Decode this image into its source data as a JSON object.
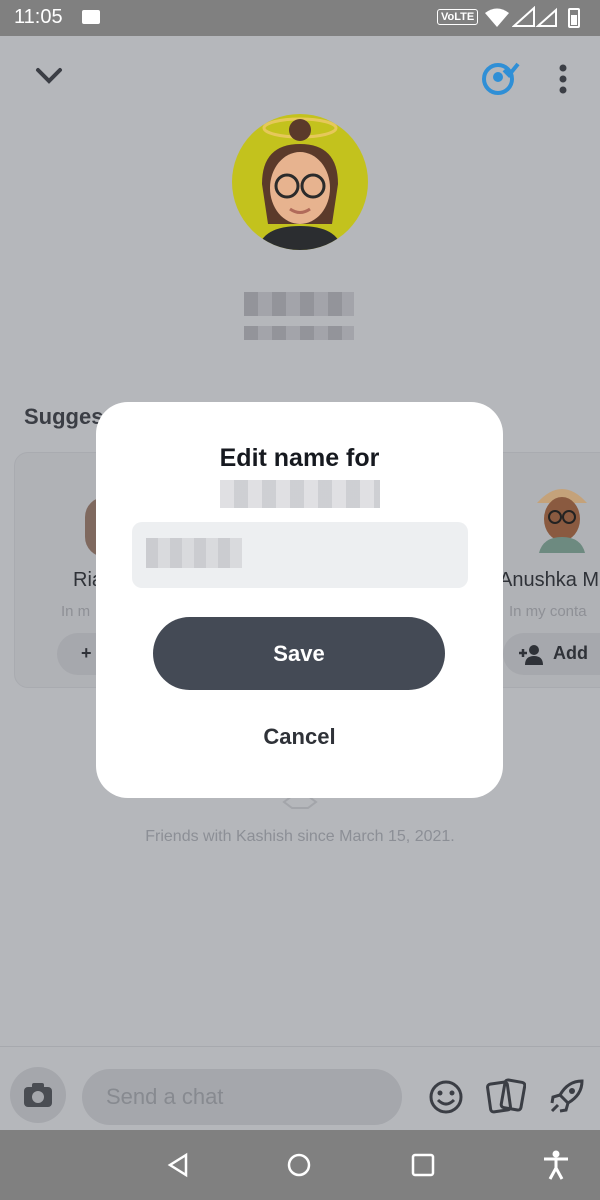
{
  "status_bar": {
    "time": "11:05",
    "network": "VoLTE"
  },
  "profile": {
    "avatar": "bitmoji-avatar"
  },
  "suggestions": {
    "title": "Sugges",
    "cards": [
      {
        "name": "Ria",
        "subtitle": "In m",
        "add_label": "+"
      },
      {
        "name": "Anushka M",
        "subtitle": "In my conta",
        "add_label": "Add"
      }
    ]
  },
  "friends_since": "Friends with Kashish since March 15, 2021.",
  "chat": {
    "placeholder": "Send a chat"
  },
  "dialog": {
    "title": "Edit name for",
    "save_label": "Save",
    "cancel_label": "Cancel"
  },
  "icons": {
    "back": "chevron-down-icon",
    "friendship": "friendship-profile-icon",
    "more": "more-vertical-icon",
    "camera": "camera-icon",
    "emoji": "emoji-icon",
    "cards": "cards-icon",
    "rocket": "rocket-icon",
    "nav_back": "nav-back-icon",
    "nav_home": "nav-home-icon",
    "nav_recents": "nav-recents-icon",
    "accessibility": "accessibility-icon"
  },
  "colors": {
    "accent": "#2f9bea",
    "dialog_button": "#444a55"
  }
}
